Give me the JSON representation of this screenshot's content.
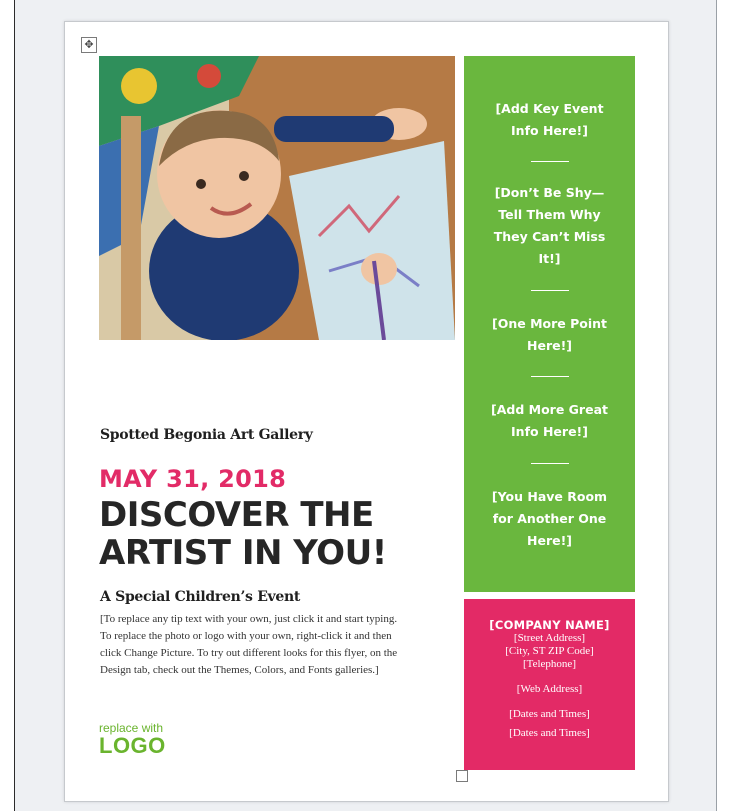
{
  "table_handle_icon": "move-icon",
  "photo": {
    "description_icon": "photo-icon"
  },
  "gallery_name": "Spotted Begonia Art Gallery",
  "date": "MAY 31, 2018",
  "headline_line1": "DISCOVER THE",
  "headline_line2": "ARTIST IN YOU!",
  "subhead": "A Special Children’s Event",
  "body_lines": [
    "[To replace any tip text with your own, just click it and start typing.",
    "To replace the photo or logo with your own, right-click it and then",
    "click Change Picture. To try out different looks for this flyer, on the",
    "Design tab, check out the Themes, Colors, and Fonts galleries.]"
  ],
  "logo": {
    "small": "replace with",
    "big": "LOGO"
  },
  "green_panel": {
    "items": [
      [
        "[Add Key Event",
        "Info Here!]"
      ],
      [
        "[Don’t Be Shy—",
        "Tell Them Why",
        "They Can’t Miss",
        "It!]"
      ],
      [
        "[One More Point",
        "Here!]"
      ],
      [
        "[Add More Great",
        "Info Here!]"
      ],
      [
        "[You Have Room",
        "for Another One",
        "Here!]"
      ]
    ]
  },
  "pink_panel": {
    "company": "[COMPANY NAME]",
    "street": "[Street Address]",
    "city": "[City, ST  ZIP Code]",
    "phone": "[Telephone]",
    "web": "[Web Address]",
    "dates1": "[Dates and Times]",
    "dates2": "[Dates and Times]"
  },
  "colors": {
    "green": "#6ab73e",
    "pink": "#e32a66",
    "logo": "#6ab42e"
  }
}
